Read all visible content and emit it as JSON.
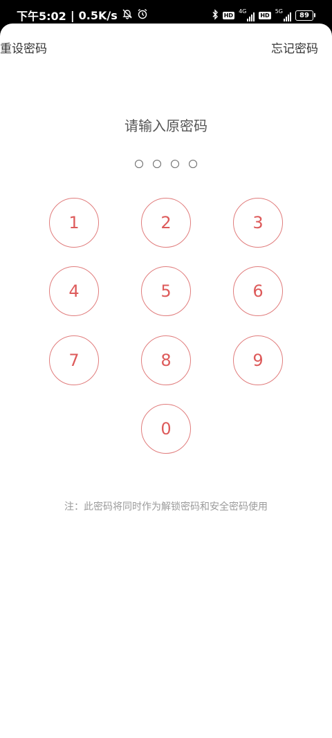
{
  "status_bar": {
    "time": "下午5:02",
    "speed": "0.5K/s",
    "network_1": "4G",
    "network_2": "5G",
    "battery": "89",
    "icons": [
      "mute-bell-icon",
      "alarm-icon",
      "bluetooth-icon",
      "hd-icon",
      "signal-icon",
      "battery-icon"
    ]
  },
  "header": {
    "title": "重设密码",
    "forgot_label": "忘记密码"
  },
  "prompt": "请输入原密码",
  "pin_length": 4,
  "keypad": {
    "k1": "1",
    "k2": "2",
    "k3": "3",
    "k4": "4",
    "k5": "5",
    "k6": "6",
    "k7": "7",
    "k8": "8",
    "k9": "9",
    "k0": "0"
  },
  "note": "注：此密码将同时作为解锁密码和安全密码使用",
  "colors": {
    "accent": "#dd5a5a",
    "key_border": "#e07b7b",
    "text": "#333333",
    "note": "#9a9a9a"
  }
}
